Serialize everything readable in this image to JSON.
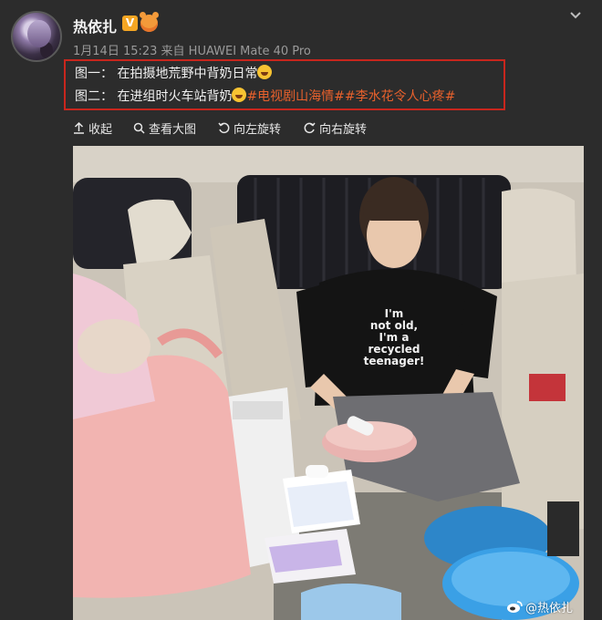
{
  "post": {
    "username": "热依扎",
    "verified_badge": "V",
    "meta": "1月14日 15:23 来自 HUAWEI Mate 40 Pro",
    "caption": {
      "line1_text": "图一：  在拍摄地荒野中背奶日常",
      "line2_prefix": "图二：  在进组时火车站背奶",
      "hashtag1": "#电视剧山海情#",
      "hashtag2": "#李水花令人心疼#"
    },
    "highlight_color": "#c8261d",
    "hashtag_color": "#e8612c"
  },
  "toolbar": {
    "collapse": "收起",
    "view_large": "查看大图",
    "rotate_left": "向左旋转",
    "rotate_right": "向右旋转"
  },
  "photo": {
    "shirt_text": "I'm not old, I'm a recycled teenager!",
    "watermark": "@热依扎"
  }
}
